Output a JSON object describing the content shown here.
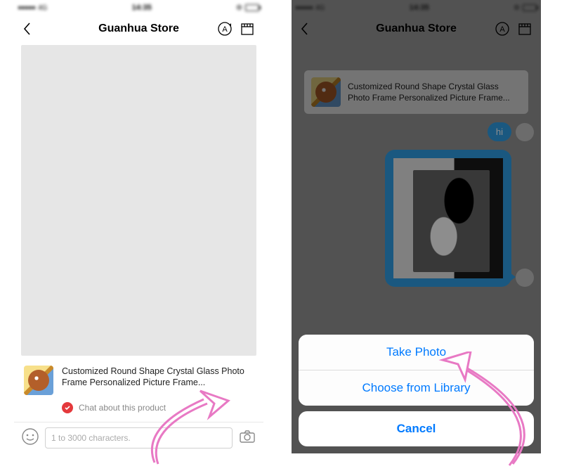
{
  "statusbar": {
    "time": "14:35"
  },
  "navbar": {
    "title": "Guanhua Store"
  },
  "product": {
    "title": "Customized Round Shape Crystal Glass Photo Frame Personalized Picture Frame...",
    "chat_about": "Chat about this product"
  },
  "input": {
    "placeholder": "1 to 3000 characters."
  },
  "messages": {
    "hi": "hi"
  },
  "action_sheet": {
    "take_photo": "Take Photo",
    "choose_library": "Choose from Library",
    "cancel": "Cancel"
  },
  "colors": {
    "ios_blue": "#007aff",
    "bubble_blue": "#2fa0e8",
    "accent_red": "#e4393c"
  },
  "icons": {
    "back": "chevron-left",
    "refresh_a": "circle-A",
    "store": "storefront",
    "smile": "emoji",
    "camera": "camera",
    "check": "checkmark"
  }
}
